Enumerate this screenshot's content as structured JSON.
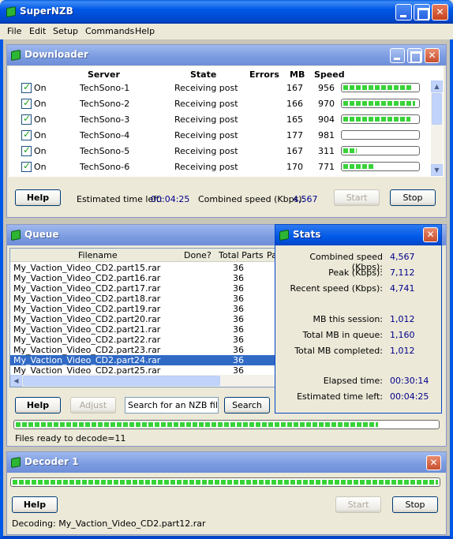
{
  "window": {
    "title": "SuperNZB"
  },
  "menu": [
    "File",
    "Edit",
    "Setup",
    "Commands",
    "Help"
  ],
  "downloader": {
    "title": "Downloader",
    "columns": {
      "server": "Server",
      "state": "State",
      "errors": "Errors",
      "mb": "MB",
      "speed": "Speed"
    },
    "rows": [
      {
        "enabled": "On",
        "server": "TechSono-1",
        "state": "Receiving post",
        "errors": "",
        "mb": "167",
        "speed": "956",
        "progress": 0.93
      },
      {
        "enabled": "On",
        "server": "TechSono-2",
        "state": "Receiving post",
        "errors": "",
        "mb": "166",
        "speed": "970",
        "progress": 0.97
      },
      {
        "enabled": "On",
        "server": "TechSono-3",
        "state": "Receiving post",
        "errors": "",
        "mb": "165",
        "speed": "904",
        "progress": 0.9
      },
      {
        "enabled": "On",
        "server": "TechSono-4",
        "state": "Receiving post",
        "errors": "",
        "mb": "177",
        "speed": "981",
        "progress": 0.0
      },
      {
        "enabled": "On",
        "server": "TechSono-5",
        "state": "Receiving post",
        "errors": "",
        "mb": "167",
        "speed": "311",
        "progress": 0.18
      },
      {
        "enabled": "On",
        "server": "TechSono-6",
        "state": "Receiving post",
        "errors": "",
        "mb": "170",
        "speed": "771",
        "progress": 0.4
      }
    ],
    "help_label": "Help",
    "eta_label": "Estimated time left:",
    "eta_value": "00:04:25",
    "speed_label": "Combined speed (Kbps):",
    "speed_value": "4,567",
    "start_label": "Start",
    "stop_label": "Stop"
  },
  "queue": {
    "title": "Queue",
    "columns": {
      "filename": "Filename",
      "done": "Done?",
      "total_parts": "Total Parts",
      "partial": "Pa"
    },
    "rows": [
      {
        "filename": "My_Vaction_Video_CD2.part15.rar",
        "total_parts": "36"
      },
      {
        "filename": "My_Vaction_Video_CD2.part16.rar",
        "total_parts": "36"
      },
      {
        "filename": "My_Vaction_Video_CD2.part17.rar",
        "total_parts": "36"
      },
      {
        "filename": "My_Vaction_Video_CD2.part18.rar",
        "total_parts": "36"
      },
      {
        "filename": "My_Vaction_Video_CD2.part19.rar",
        "total_parts": "36"
      },
      {
        "filename": "My_Vaction_Video_CD2.part20.rar",
        "total_parts": "36"
      },
      {
        "filename": "My_Vaction_Video_CD2.part21.rar",
        "total_parts": "36"
      },
      {
        "filename": "My_Vaction_Video_CD2.part22.rar",
        "total_parts": "36"
      },
      {
        "filename": "My_Vaction_Video_CD2.part23.rar",
        "total_parts": "36"
      },
      {
        "filename": "My_Vaction_Video_CD2.part24.rar",
        "total_parts": "36",
        "selected": true
      },
      {
        "filename": "My_Vaction_Video_CD2.part25.rar",
        "total_parts": "36"
      }
    ],
    "help_label": "Help",
    "adjust_label": "Adjust",
    "search_placeholder": "Search for an NZB file...",
    "search_label": "Search",
    "progress": 0.86,
    "status": "Files ready to decode=11"
  },
  "stats": {
    "title": "Stats",
    "items": [
      {
        "label": "Combined speed (Kbps):",
        "value": "4,567"
      },
      {
        "label": "Peak (Kbps):",
        "value": "7,112"
      },
      {
        "label": "Recent speed (Kbps):",
        "value": "4,741"
      },
      {
        "label": "MB this session:",
        "value": "1,012"
      },
      {
        "label": "Total MB in queue:",
        "value": "1,160"
      },
      {
        "label": "Total MB completed:",
        "value": "1,012"
      },
      {
        "label": "Elapsed time:",
        "value": "00:30:14"
      },
      {
        "label": "Estimated time left:",
        "value": "00:04:25"
      }
    ]
  },
  "decoder": {
    "title": "Decoder 1",
    "progress": 1.0,
    "help_label": "Help",
    "start_label": "Start",
    "stop_label": "Stop",
    "status": "Decoding: My_Vaction_Video_CD2.part12.rar"
  }
}
